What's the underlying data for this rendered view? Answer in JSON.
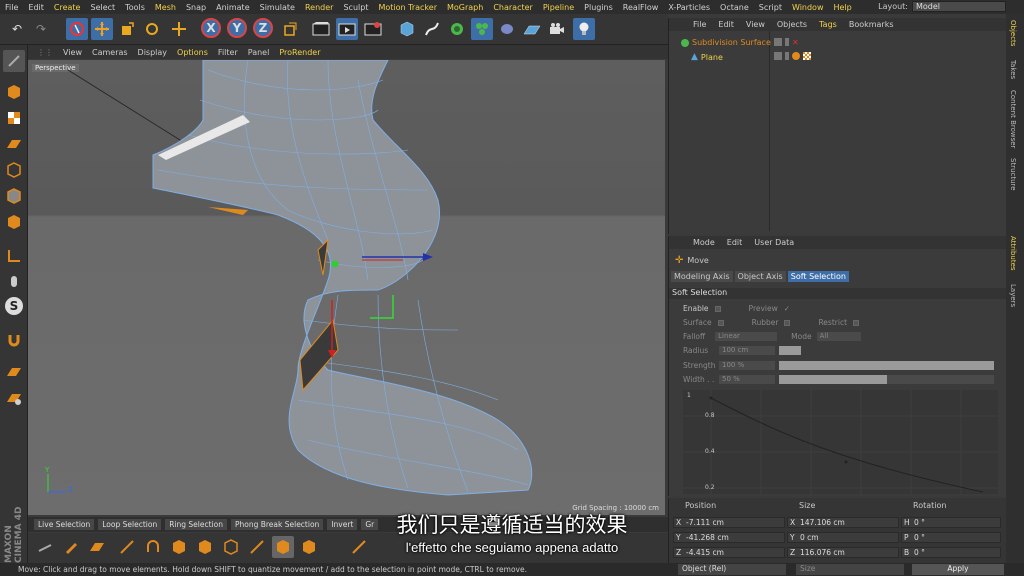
{
  "menu": [
    "File",
    "Edit",
    "Create",
    "Select",
    "Tools",
    "Mesh",
    "Snap",
    "Animate",
    "Simulate",
    "Render",
    "Sculpt",
    "Motion Tracker",
    "MoGraph",
    "Character",
    "Pipeline",
    "Plugins",
    "RealFlow",
    "X-Particles",
    "Octane",
    "Script",
    "Window",
    "Help"
  ],
  "menu_highlight": [
    "Create",
    "Mesh",
    "Render",
    "Motion Tracker",
    "MoGraph",
    "Character",
    "Pipeline",
    "Window",
    "Help"
  ],
  "layout": {
    "label": "Layout:",
    "value": "Model"
  },
  "toolbar": {
    "undo": "↶",
    "redo": "↷",
    "x": "X",
    "y": "Y",
    "z": "Z"
  },
  "viewport_menu": {
    "items": [
      "View",
      "Cameras",
      "Display",
      "Options",
      "Filter",
      "Panel",
      "ProRender"
    ],
    "highlight": [
      "Options",
      "ProRender"
    ]
  },
  "viewport": {
    "label": "Perspective",
    "grid_spacing": "Grid Spacing : 10000 cm"
  },
  "bottom_tabs": [
    "Live Selection",
    "Loop Selection",
    "Ring Selection",
    "Phong Break Selection",
    "Invert",
    "Gr"
  ],
  "status": "Move: Click and drag to move elements. Hold down SHIFT to quantize movement / add to the selection in point mode, CTRL to remove.",
  "objects": {
    "menu": [
      "File",
      "Edit",
      "View",
      "Objects",
      "Tags",
      "Bookmarks"
    ],
    "menu_highlight": [
      "Tags"
    ],
    "items": [
      {
        "name": "Subdivision Surface"
      },
      {
        "name": "Plane"
      }
    ]
  },
  "attributes": {
    "menu": [
      "Mode",
      "Edit",
      "User Data"
    ],
    "tool": "Move",
    "tabs": [
      "Modeling Axis",
      "Object Axis",
      "Soft Selection"
    ],
    "active_tab": "Soft Selection",
    "section": "Soft Selection",
    "enable": "Enable",
    "preview": "Preview",
    "surface": "Surface",
    "rubber": "Rubber",
    "restrict": "Restrict",
    "falloff": {
      "label": "Falloff",
      "value": "Linear"
    },
    "mode": {
      "label": "Mode",
      "value": "All"
    },
    "radius": {
      "label": "Radius",
      "value": "100 cm"
    },
    "strength": {
      "label": "Strength",
      "value": "100 %",
      "level": 1.0
    },
    "width": {
      "label": "Width . .",
      "value": "50 %",
      "level": 0.5
    },
    "curve_labels": [
      "1",
      "0.8",
      "0.4",
      "0.2"
    ]
  },
  "coordinates": {
    "headers": [
      "Position",
      "Size",
      "Rotation"
    ],
    "rows": [
      {
        "axis": "X",
        "pos": "-7.111 cm",
        "size_axis": "X",
        "size": "147.106 cm",
        "rot_axis": "H",
        "rot": "0 °"
      },
      {
        "axis": "Y",
        "pos": "-41.268 cm",
        "size_axis": "Y",
        "size": "0 cm",
        "rot_axis": "P",
        "rot": "0 °"
      },
      {
        "axis": "Z",
        "pos": "-4.415 cm",
        "size_axis": "Z",
        "size": "116.076 cm",
        "rot_axis": "B",
        "rot": "0 °"
      }
    ],
    "mode": "Object (Rel)",
    "size_mode": "Size",
    "apply": "Apply"
  },
  "right_tabs": [
    "Objects",
    "Takes",
    "Content Browser",
    "Structure",
    "Attributes",
    "Layers"
  ],
  "logo": "MAXON CINEMA 4D",
  "subtitles": {
    "zh": "我们只是遵循适当的效果",
    "it": "l'effetto che seguiamo appena adatto"
  },
  "colors": {
    "accent": "#f0d24c",
    "orange": "#e08a1e",
    "blue_active": "#3e6ea8"
  }
}
